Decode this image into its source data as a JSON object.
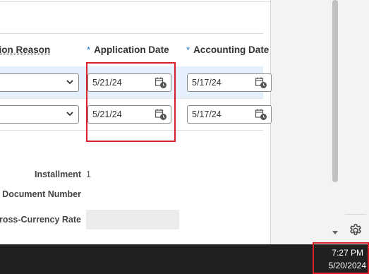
{
  "table": {
    "columns": [
      {
        "label": "tion Reason",
        "required": false
      },
      {
        "label": "Application Date",
        "required": true,
        "required_mark": "*"
      },
      {
        "label": "Accounting Date",
        "required": true,
        "required_mark": "*"
      }
    ],
    "rows": [
      {
        "application_date": "5/21/24",
        "accounting_date": "5/17/24",
        "selected": true
      },
      {
        "application_date": "5/21/24",
        "accounting_date": "5/17/24",
        "selected": false
      }
    ]
  },
  "details": {
    "installment_label": "Installment",
    "installment_value": "1",
    "document_number_label": "Document Number",
    "cross_currency_rate_label": "Cross-Currency Rate"
  },
  "taskbar": {
    "time": "7:27 PM",
    "date": "5/20/2024"
  },
  "colors": {
    "accent": "#1a6fc9",
    "highlight": "#d6212a",
    "selected_row": "#e4f0fb",
    "taskbar": "#202020"
  }
}
